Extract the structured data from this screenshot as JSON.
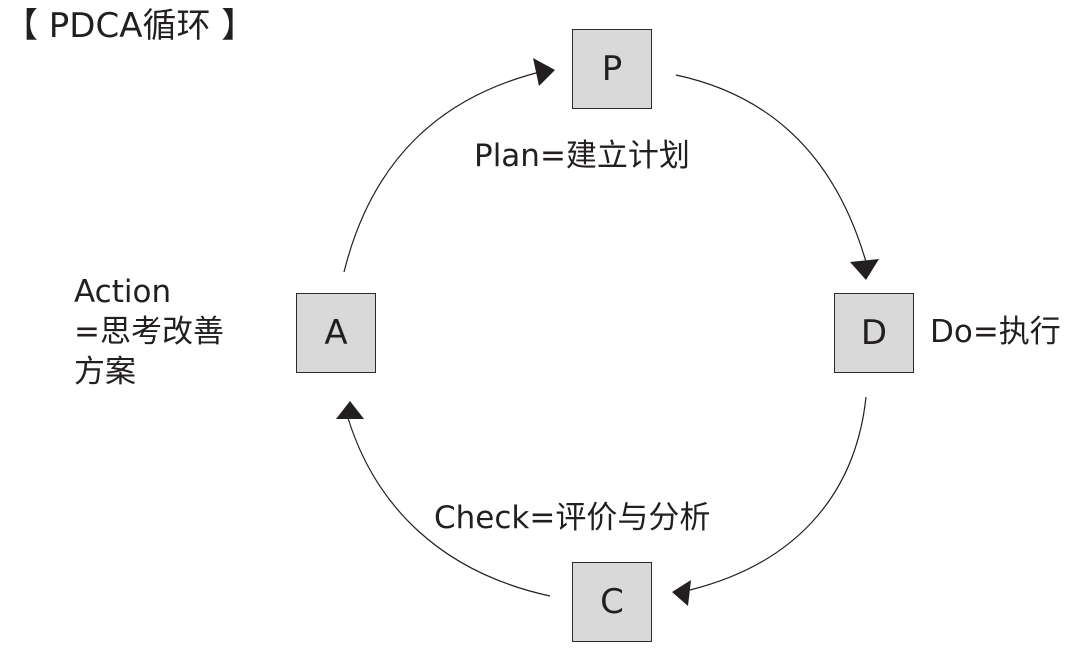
{
  "title": "【 PDCA循环 】",
  "nodes": {
    "p": "P",
    "d": "D",
    "c": "C",
    "a": "A"
  },
  "labels": {
    "plan": "Plan=建立计划",
    "do": "Do=执行",
    "check": "Check=评价与分析",
    "action_line1": "Action",
    "action_line2": "=思考改善",
    "action_line3": "方案"
  },
  "colors": {
    "box_fill": "#d9d9d9",
    "line": "#231f20"
  }
}
